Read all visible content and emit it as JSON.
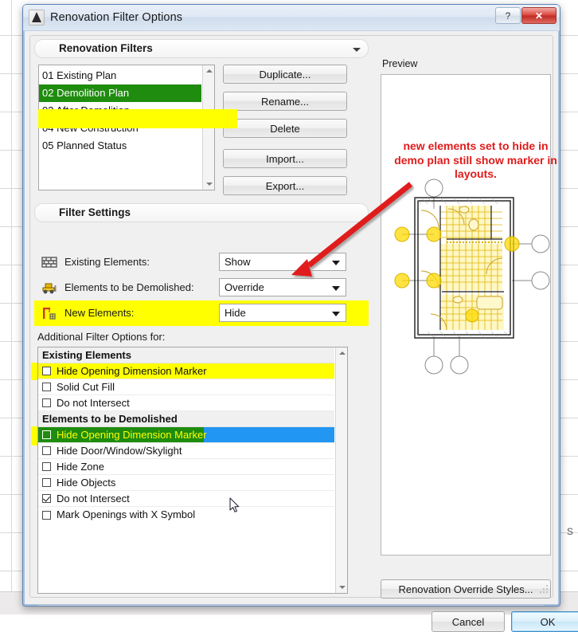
{
  "window": {
    "title": "Renovation Filter Options",
    "app_icon": "archicad-icon",
    "help_button": "?",
    "close_button": "✕"
  },
  "renovation_filters": {
    "group_title": "Renovation Filters",
    "items": [
      {
        "label": "01 Existing Plan",
        "selected": false,
        "highlighted": false
      },
      {
        "label": "02 Demolition Plan",
        "selected": true,
        "highlighted": true
      },
      {
        "label": "03 After Demolition",
        "selected": false,
        "highlighted": false
      },
      {
        "label": "04 New Construction",
        "selected": false,
        "highlighted": false
      },
      {
        "label": "05 Planned Status",
        "selected": false,
        "highlighted": false
      }
    ],
    "buttons": [
      {
        "label": "Duplicate..."
      },
      {
        "label": "Rename..."
      },
      {
        "label": "Delete"
      },
      {
        "label": "Import..."
      },
      {
        "label": "Export..."
      }
    ]
  },
  "filter_settings": {
    "group_title": "Filter Settings",
    "rows": [
      {
        "icon": "brick-wall-icon",
        "label": "Existing Elements:",
        "value": "Show",
        "highlighted": false
      },
      {
        "icon": "bulldozer-icon",
        "label": "Elements to be Demolished:",
        "value": "Override",
        "highlighted": false
      },
      {
        "icon": "crane-icon",
        "label": "New Elements:",
        "value": "Hide",
        "highlighted": true
      }
    ]
  },
  "additional_filter_options": {
    "label": "Additional Filter Options for:",
    "groups": [
      {
        "header": "Existing Elements",
        "header_highlighted": true,
        "rows": [
          {
            "label": "Hide Opening Dimension Marker",
            "checked": false,
            "highlighted": true,
            "selected": false
          },
          {
            "label": "Solid Cut Fill",
            "checked": false,
            "highlighted": false,
            "selected": false
          },
          {
            "label": "Do not Intersect",
            "checked": false,
            "highlighted": false,
            "selected": false
          }
        ]
      },
      {
        "header": "Elements to be Demolished",
        "header_highlighted": true,
        "rows": [
          {
            "label": "Hide Opening Dimension Marker",
            "checked": false,
            "highlighted": true,
            "selected": true
          },
          {
            "label": "Hide Door/Window/Skylight",
            "checked": false,
            "highlighted": false,
            "selected": false
          },
          {
            "label": "Hide Zone",
            "checked": false,
            "highlighted": false,
            "selected": false
          },
          {
            "label": "Hide Objects",
            "checked": false,
            "highlighted": false,
            "selected": false
          },
          {
            "label": "Do not Intersect",
            "checked": true,
            "highlighted": false,
            "selected": false
          },
          {
            "label": "Mark Openings with X Symbol",
            "checked": false,
            "highlighted": false,
            "selected": false
          }
        ]
      }
    ]
  },
  "preview": {
    "label": "Preview",
    "content": "floor-plan-preview"
  },
  "annotation": {
    "text": "new elements set to hide in demo plan still show marker in layouts.",
    "color": "#e01b1b",
    "arrow": "red-arrow-pointing-to-new-elements-dropdown"
  },
  "footer": {
    "override_styles_label": "Renovation Override Styles...",
    "cancel_label": "Cancel",
    "ok_label": "OK"
  },
  "background": {
    "stray_text": "s"
  },
  "colors": {
    "highlight_yellow": "#ffff00",
    "list_selection_green": "#1f8c0f",
    "list_selection_blue": "#2196f3",
    "annotation_red": "#e01b1b",
    "dialog_face": "#f0f0f0"
  }
}
